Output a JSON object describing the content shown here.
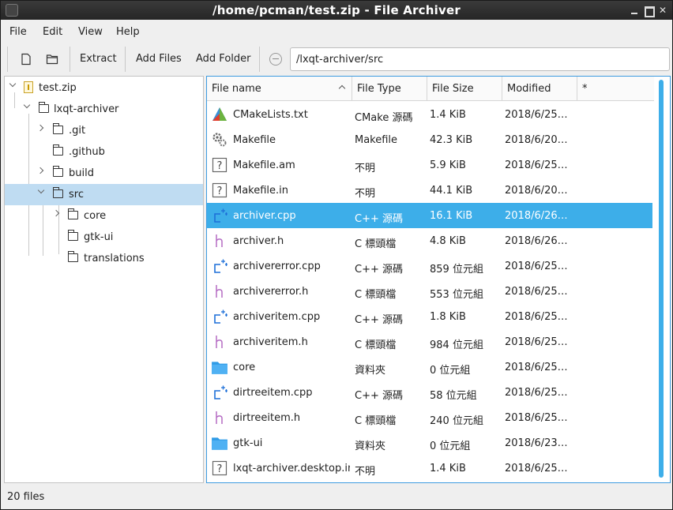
{
  "window": {
    "title": "/home/pcman/test.zip - File Archiver"
  },
  "menu": [
    "File",
    "Edit",
    "View",
    "Help"
  ],
  "toolbar": {
    "extract_label": "Extract",
    "add_files_label": "Add Files",
    "add_folder_label": "Add Folder",
    "path_value": "/lxqt-archiver/src"
  },
  "tree": [
    {
      "label": "test.zip",
      "type": "zip"
    },
    {
      "label": "lxqt-archiver",
      "type": "folder"
    },
    {
      "label": ".git",
      "type": "folder"
    },
    {
      "label": ".github",
      "type": "folder"
    },
    {
      "label": "build",
      "type": "folder"
    },
    {
      "label": "src",
      "type": "folder"
    },
    {
      "label": "core",
      "type": "folder"
    },
    {
      "label": "gtk-ui",
      "type": "folder"
    },
    {
      "label": "translations",
      "type": "folder"
    }
  ],
  "columns": [
    "File name",
    "File Type",
    "File Size",
    "Modified",
    "*"
  ],
  "files": [
    {
      "name": "CMakeLists.txt",
      "type": "CMake 源碼",
      "size": "1.4 KiB",
      "modified": "2018/6/25…",
      "icon": "cmake-icon"
    },
    {
      "name": "Makefile",
      "type": "Makefile",
      "size": "42.3 KiB",
      "modified": "2018/6/20…",
      "icon": "gear-icon"
    },
    {
      "name": "Makefile.am",
      "type": "不明",
      "size": "5.9 KiB",
      "modified": "2018/6/25…",
      "icon": "unknown-icon"
    },
    {
      "name": "Makefile.in",
      "type": "不明",
      "size": "44.1 KiB",
      "modified": "2018/6/20…",
      "icon": "unknown-icon"
    },
    {
      "name": "archiver.cpp",
      "type": "C++ 源碼",
      "size": "16.1 KiB",
      "modified": "2018/6/26…",
      "icon": "cpp-icon"
    },
    {
      "name": "archiver.h",
      "type": "C 標頭檔",
      "size": "4.8 KiB",
      "modified": "2018/6/26…",
      "icon": "header-icon"
    },
    {
      "name": "archivererror.cpp",
      "type": "C++ 源碼",
      "size": "859 位元組",
      "modified": "2018/6/25…",
      "icon": "cpp-icon"
    },
    {
      "name": "archivererror.h",
      "type": "C 標頭檔",
      "size": "553 位元組",
      "modified": "2018/6/25…",
      "icon": "header-icon"
    },
    {
      "name": "archiveritem.cpp",
      "type": "C++ 源碼",
      "size": "1.8 KiB",
      "modified": "2018/6/25…",
      "icon": "cpp-icon"
    },
    {
      "name": "archiveritem.h",
      "type": "C 標頭檔",
      "size": "984 位元組",
      "modified": "2018/6/25…",
      "icon": "header-icon"
    },
    {
      "name": "core",
      "type": "資料夾",
      "size": "0 位元組",
      "modified": "2018/6/25…",
      "icon": "folder-icon"
    },
    {
      "name": "dirtreeitem.cpp",
      "type": "C++ 源碼",
      "size": "58 位元組",
      "modified": "2018/6/25…",
      "icon": "cpp-icon"
    },
    {
      "name": "dirtreeitem.h",
      "type": "C 標頭檔",
      "size": "240 位元組",
      "modified": "2018/6/25…",
      "icon": "header-icon"
    },
    {
      "name": "gtk-ui",
      "type": "資料夾",
      "size": "0 位元組",
      "modified": "2018/6/23…",
      "icon": "folder-icon"
    },
    {
      "name": "lxqt-archiver.desktop.in",
      "type": "不明",
      "size": "1.4 KiB",
      "modified": "2018/6/25…",
      "icon": "unknown-icon"
    }
  ],
  "selected_file": "archiver.cpp",
  "status": {
    "text": "20 files"
  },
  "colors": {
    "selection": "#3daee9",
    "tree_selection": "#bfdcf2",
    "titlebar": "#2f2f2f"
  }
}
